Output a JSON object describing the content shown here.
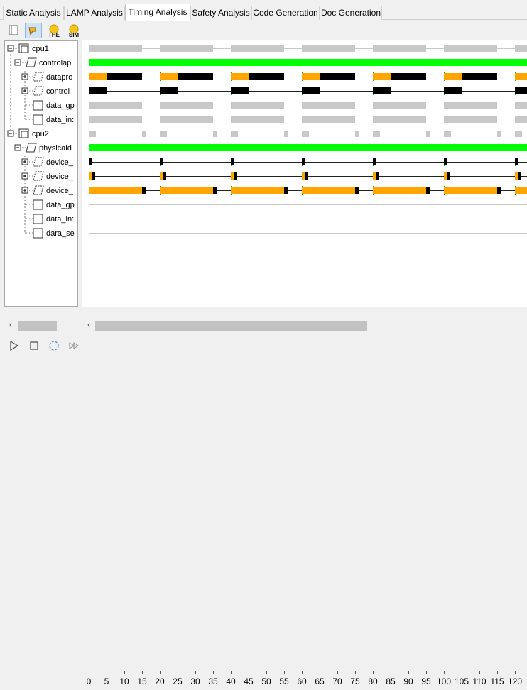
{
  "tabs": [
    {
      "label": "Static Analysis",
      "active": false
    },
    {
      "label": "LAMP Analysis",
      "active": false
    },
    {
      "label": "Timing Analysis",
      "active": true
    },
    {
      "label": "Safety Analysis",
      "active": false
    },
    {
      "label": "Code Generation",
      "active": false
    },
    {
      "label": "Doc Generation",
      "active": false
    }
  ],
  "toolbar": {
    "buttons": [
      {
        "icon": "panel-icon",
        "label": ""
      },
      {
        "icon": "pointer-icon",
        "label": ""
      },
      {
        "icon": "the-icon",
        "label": "THE"
      },
      {
        "icon": "sim-icon",
        "label": "SIM"
      }
    ]
  },
  "tree": {
    "items": [
      {
        "label": "cpu1",
        "level": 0,
        "expander": "minus",
        "icon": "folder"
      },
      {
        "label": "controlap",
        "level": 1,
        "expander": "minus",
        "icon": "para"
      },
      {
        "label": "datapro",
        "level": 2,
        "expander": "plus",
        "icon": "dashed"
      },
      {
        "label": "control",
        "level": 2,
        "expander": "plus",
        "icon": "dashed"
      },
      {
        "label": "data_gp",
        "level": 2,
        "expander": "none",
        "icon": "box"
      },
      {
        "label": "data_in:",
        "level": 2,
        "expander": "none",
        "icon": "box"
      },
      {
        "label": "cpu2",
        "level": 0,
        "expander": "minus",
        "icon": "folder"
      },
      {
        "label": "physicald",
        "level": 1,
        "expander": "minus",
        "icon": "para"
      },
      {
        "label": "device_",
        "level": 2,
        "expander": "plus",
        "icon": "dashed"
      },
      {
        "label": "device_",
        "level": 2,
        "expander": "plus",
        "icon": "dashed"
      },
      {
        "label": "device_",
        "level": 2,
        "expander": "plus",
        "icon": "dashed"
      },
      {
        "label": "data_gp",
        "level": 2,
        "expander": "none",
        "icon": "box"
      },
      {
        "label": "data_in:",
        "level": 2,
        "expander": "none",
        "icon": "box"
      },
      {
        "label": "dara_se",
        "level": 2,
        "expander": "none",
        "icon": "box"
      }
    ]
  },
  "timeline": {
    "visible_range": [
      0,
      122
    ],
    "ticks": [
      "0",
      "5",
      "10",
      "15",
      "20",
      "25",
      "30",
      "35",
      "40",
      "45",
      "50",
      "55",
      "60",
      "65",
      "70",
      "75",
      "80",
      "85",
      "90",
      "95",
      "100",
      "105",
      "110",
      "115",
      "120"
    ],
    "colors": {
      "gray": "#c8c8c8",
      "green": "#00ff00",
      "orange": "#ffa500",
      "black": "#000000",
      "tick": "#1aa31a",
      "line": "#222222"
    },
    "rows": [
      {
        "kind": "gray",
        "period": 20,
        "segments": [
          {
            "start": 0,
            "end": 15,
            "color": "gray"
          }
        ],
        "line": true
      },
      {
        "kind": "full",
        "color": "green"
      },
      {
        "kind": "task",
        "period": 20,
        "segments": [
          {
            "start": 0,
            "end": 5,
            "color": "orange"
          },
          {
            "start": 5,
            "end": 15,
            "color": "black"
          }
        ],
        "line": true
      },
      {
        "kind": "task",
        "period": 20,
        "segments": [
          {
            "start": 0,
            "end": 5,
            "color": "black"
          }
        ],
        "line": true
      },
      {
        "kind": "gray",
        "period": 20,
        "segments": [
          {
            "start": 0,
            "end": 15,
            "color": "gray"
          }
        ],
        "line": false
      },
      {
        "kind": "gray",
        "period": 20,
        "segments": [
          {
            "start": 0,
            "end": 15,
            "color": "gray"
          }
        ],
        "line": false
      },
      {
        "kind": "gray-small",
        "period": 20,
        "segments": [
          {
            "start": 0,
            "end": 2,
            "color": "gray"
          },
          {
            "start": 15,
            "end": 16,
            "color": "gray"
          }
        ],
        "line": false
      },
      {
        "kind": "full",
        "color": "green"
      },
      {
        "kind": "task",
        "period": 20,
        "segments": [
          {
            "start": 0,
            "end": 1,
            "color": "black"
          }
        ],
        "line": true
      },
      {
        "kind": "task",
        "period": 20,
        "segments": [
          {
            "start": 0,
            "end": 0.8,
            "color": "orange"
          },
          {
            "start": 0.8,
            "end": 1.8,
            "color": "black"
          }
        ],
        "line": true
      },
      {
        "kind": "task",
        "period": 20,
        "segments": [
          {
            "start": 0,
            "end": 15,
            "color": "orange"
          },
          {
            "start": 15,
            "end": 16,
            "color": "black"
          }
        ],
        "line": true
      },
      {
        "kind": "empty"
      },
      {
        "kind": "empty"
      },
      {
        "kind": "empty"
      }
    ]
  },
  "playback": {
    "buttons": [
      {
        "icon": "play-icon"
      },
      {
        "icon": "stop-icon"
      },
      {
        "icon": "reset-icon"
      },
      {
        "icon": "step-icon"
      }
    ]
  },
  "scrollbars": {
    "left_thumb_fraction": 0.5,
    "main_thumb_fraction": 0.6
  }
}
